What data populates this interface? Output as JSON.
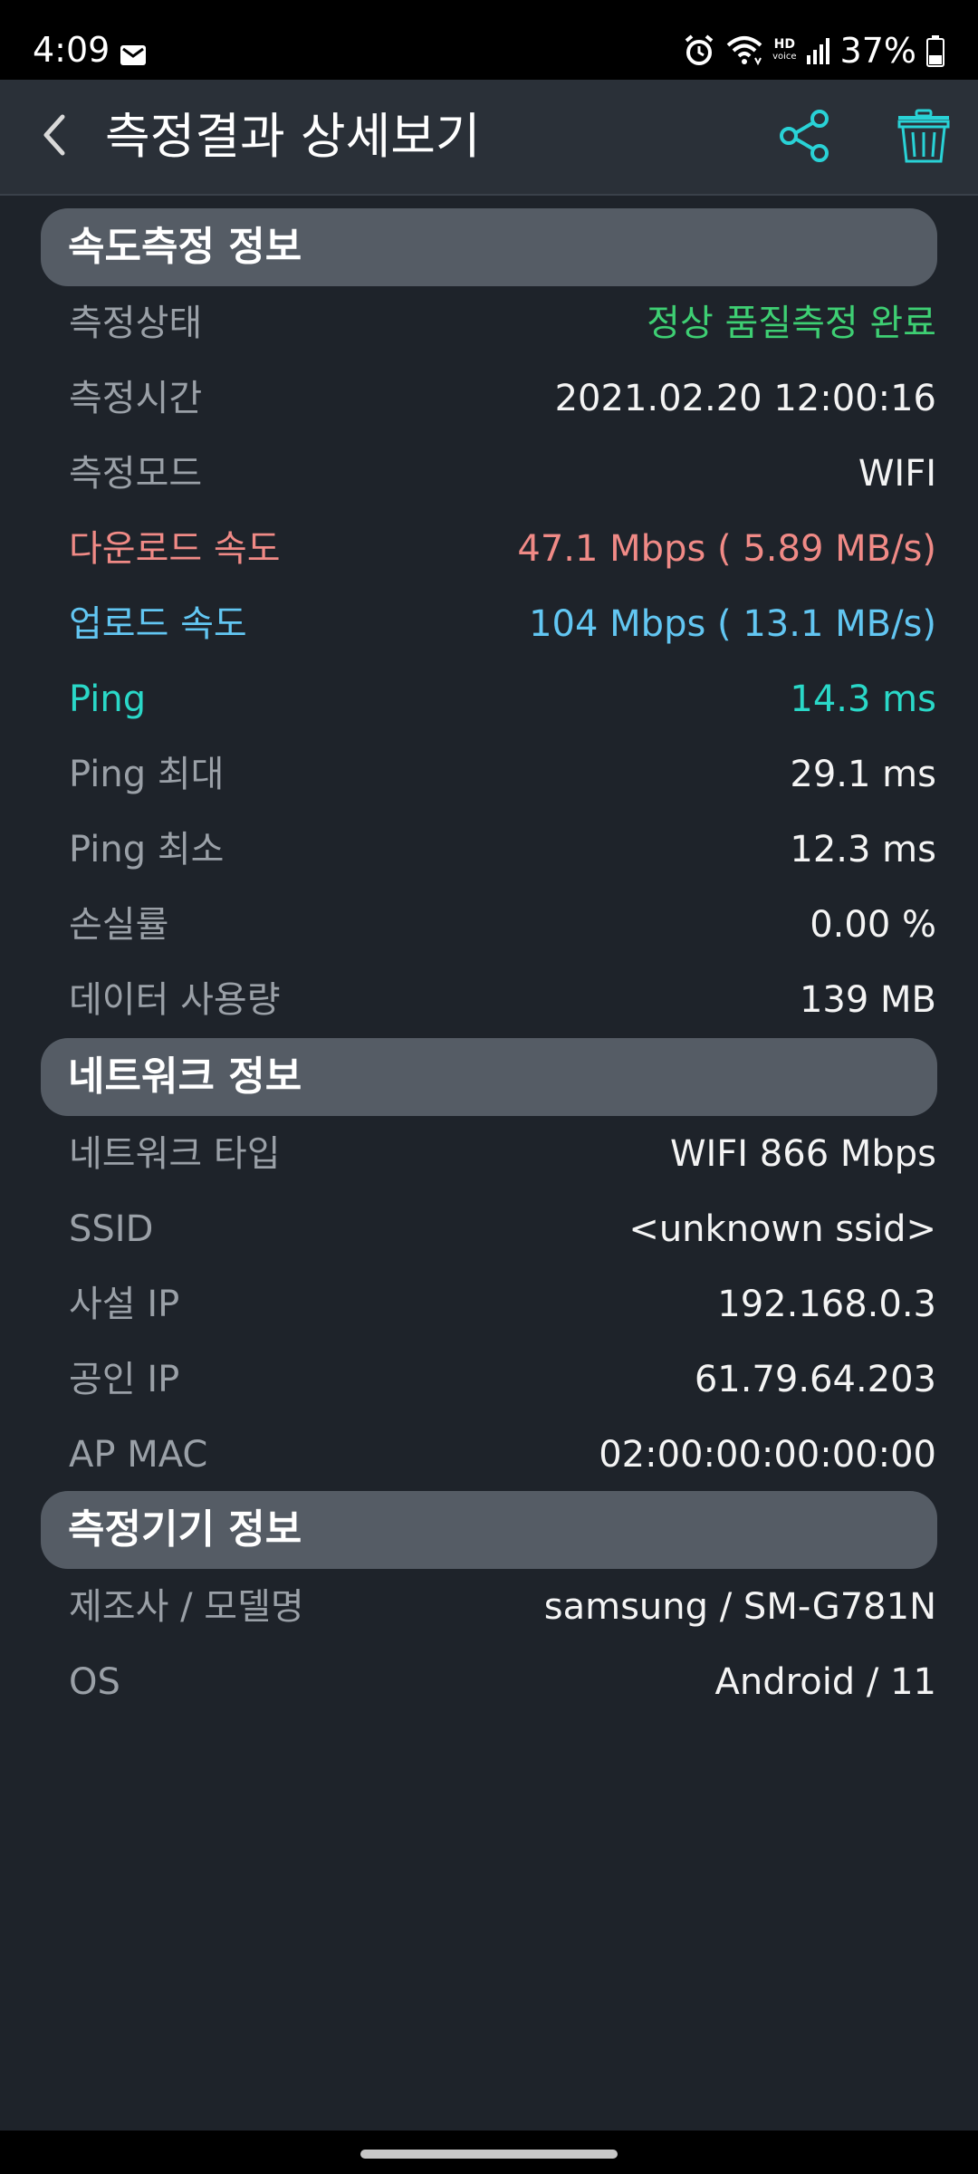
{
  "status_bar": {
    "time": "4:09",
    "hd_top": "HD",
    "hd_bottom": "voice",
    "battery_text": "37%",
    "battery_level": 0.37,
    "icons": [
      "mail-icon",
      "alarm-icon",
      "wifi-icon",
      "hd-voice-icon",
      "signal-icon",
      "battery-icon"
    ]
  },
  "header": {
    "title": "측정결과 상세보기",
    "icons": [
      "back-arrow-icon",
      "share-icon",
      "trash-icon"
    ],
    "accent_color": "#29d2d6"
  },
  "sections": [
    {
      "title": "속도측정 정보",
      "rows": [
        {
          "label": "측정상태",
          "value": "정상 품질측정 완료"
        },
        {
          "label": "측정시간",
          "value": "2021.02.20 12:00:16"
        },
        {
          "label": "측정모드",
          "value": "WIFI"
        },
        {
          "label": "다운로드 속도",
          "value": "47.1 Mbps ( 5.89 MB/s)"
        },
        {
          "label": "업로드 속도",
          "value": "104 Mbps ( 13.1 MB/s)"
        },
        {
          "label": "Ping",
          "value": "14.3 ms"
        },
        {
          "label": "Ping 최대",
          "value": "29.1 ms"
        },
        {
          "label": "Ping 최소",
          "value": "12.3 ms"
        },
        {
          "label": "손실률",
          "value": "0.00 %"
        },
        {
          "label": "데이터 사용량",
          "value": "139 MB"
        }
      ]
    },
    {
      "title": "네트워크 정보",
      "rows": [
        {
          "label": "네트워크 타입",
          "value": "WIFI 866 Mbps"
        },
        {
          "label": "SSID",
          "value": "<unknown ssid>"
        },
        {
          "label": "사설 IP",
          "value": "192.168.0.3"
        },
        {
          "label": "공인 IP",
          "value": "61.79.64.203"
        },
        {
          "label": "AP MAC",
          "value": "02:00:00:00:00:00"
        }
      ]
    },
    {
      "title": "측정기기 정보",
      "rows": [
        {
          "label": "제조사 / 모델명",
          "value": "samsung / SM-G781N"
        },
        {
          "label": "OS",
          "value": "Android / 11"
        }
      ]
    }
  ],
  "colors": {
    "status_ok": "#3ecf73",
    "download": "#f08a86",
    "upload": "#62c6f2",
    "ping": "#2ad8c8",
    "label": "#9aa0a7",
    "value": "#f4f4f4",
    "section_header_bg": "#555c65",
    "background": "#1e232a",
    "app_bar_bg": "#2a3038"
  }
}
